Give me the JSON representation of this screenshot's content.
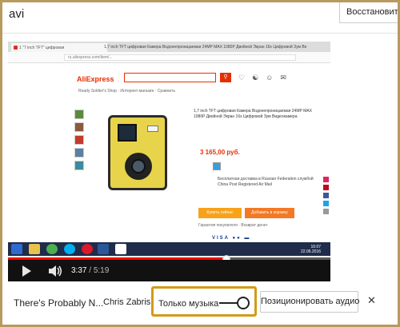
{
  "window": {
    "title": "avi",
    "restore_button": "Восстановить и"
  },
  "video": {
    "browser": {
      "tab_label": "1 \"7 inch TFT\" цифровая",
      "tab_title": "1,7 inch TFT цифровая Камера Водонепроницаемая 24MP MAX 1080P Двойной Экран 16x Цифровой Зум Ве",
      "url": "ru.aliexpress.com/item/..."
    },
    "store": {
      "logo": "AliExpress",
      "nav": "Ready Soldier's Shop · Интернет-магазин · Сравнить"
    },
    "product": {
      "title": "1,7 inch TFT цифровая Камера Водонепроницаемая 24MP MAX 1080P Двойной Экран 16x Цифровой Зум Видеокамера",
      "price": "3 165,00 руб.",
      "shipping": "Бесплатная доставка в Russian Federation службой China Post Registered Air Mail",
      "buy_now": "Купить сейчас",
      "add_to_cart": "Добавить в корзину",
      "extra": "Гарантия покупателя · Возврат денег",
      "pay": "VISA  ●●  ▬"
    },
    "taskbar_clock": {
      "time": "16:07",
      "date": "22.06.2016"
    },
    "progress_fraction": 0.677,
    "time_current": "3:37",
    "time_sep": " / ",
    "time_duration": "5:19"
  },
  "player": {
    "song_title": "There's Probably N...",
    "artist": "Chris Zabriskie",
    "music_only_label": "Только музыка",
    "music_only_on": true,
    "position_audio_button": "Позиционировать аудио",
    "close_symbol": "✕"
  },
  "colors": {
    "accent_frame": "#d39a18",
    "progress_red": "#ff0000",
    "ali_red": "#e62e04"
  }
}
